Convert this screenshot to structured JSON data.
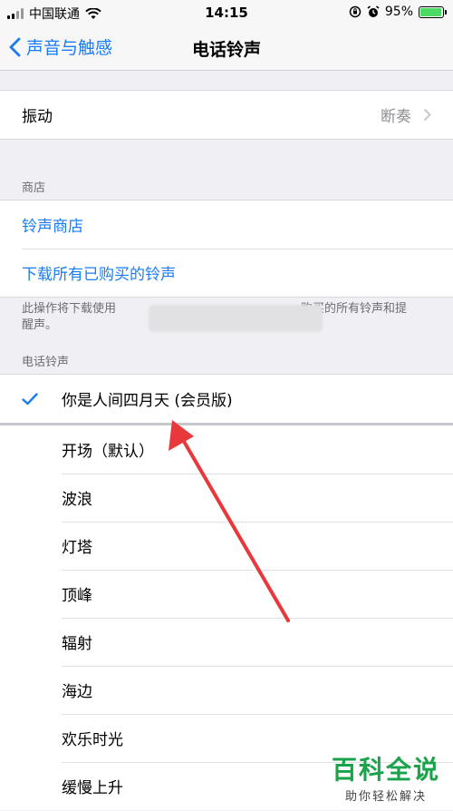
{
  "status_bar": {
    "carrier": "中国联通",
    "time": "14:15",
    "battery_percent": "95%",
    "battery_level": 0.95,
    "icons": [
      "signal-icon",
      "wifi-icon",
      "lock-rotation-icon",
      "alarm-icon",
      "battery-icon"
    ]
  },
  "nav": {
    "back_label": "声音与触感",
    "title": "电话铃声"
  },
  "vibration": {
    "label": "振动",
    "value": "断奏"
  },
  "store": {
    "header": "商店",
    "items": [
      "铃声商店",
      "下载所有已购买的铃声"
    ],
    "footer_prefix": "此操作将下载使用",
    "footer_suffix": "购买的所有铃声和提",
    "footer_line2": "醒声。",
    "accent": "#1a7cf5"
  },
  "ringtones": {
    "header": "电话铃声",
    "selected": "你是人间四月天 (会员版)",
    "items": [
      "开场（默认）",
      "波浪",
      "灯塔",
      "顶峰",
      "辐射",
      "海边",
      "欢乐时光",
      "缓慢上升"
    ]
  },
  "watermark": {
    "title": "百科全说",
    "subtitle": "助你轻松解决"
  }
}
